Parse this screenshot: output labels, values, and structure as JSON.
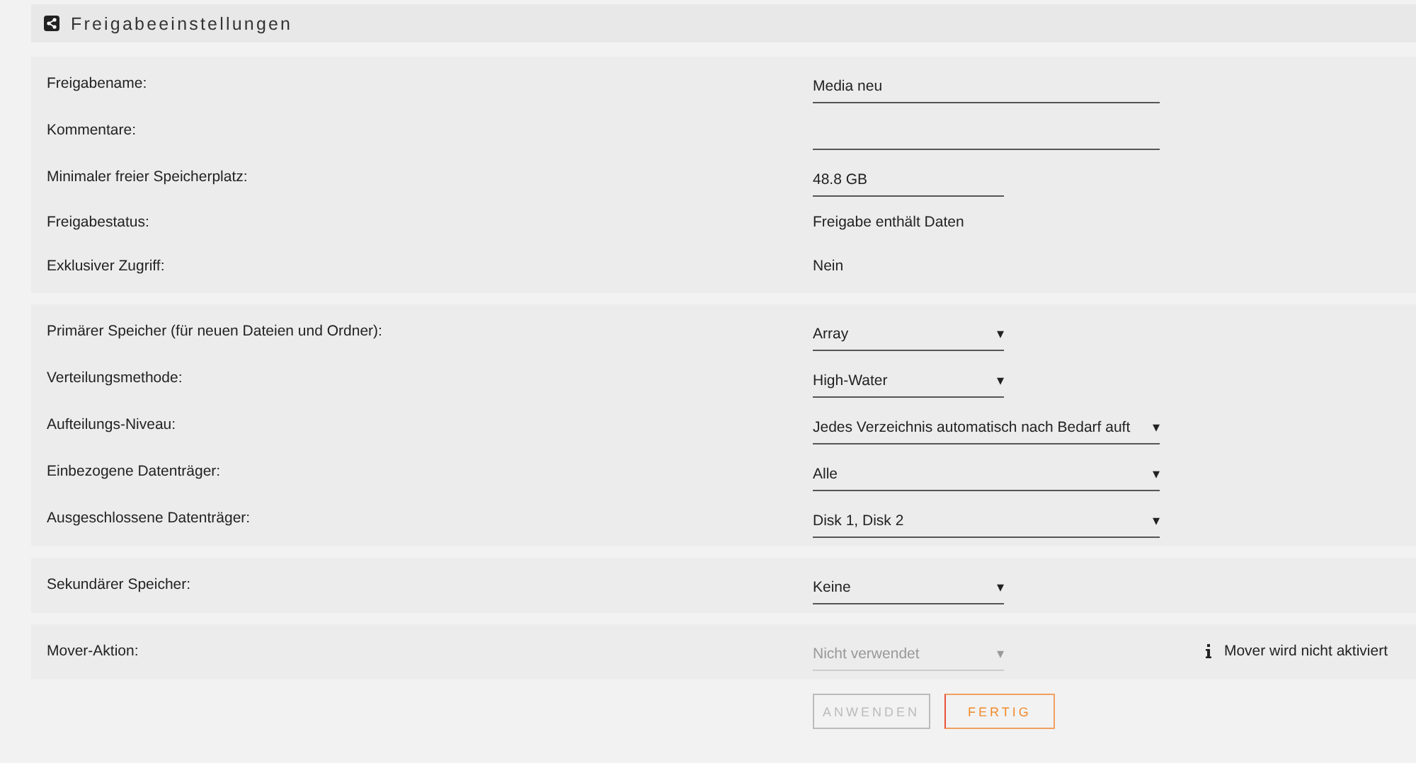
{
  "header": {
    "title": "Freigabeeinstellungen"
  },
  "sections": [
    {
      "rows": [
        {
          "label": "Freigabename:",
          "kind": "text",
          "wide": true,
          "value": "Media neu"
        },
        {
          "label": "Kommentare:",
          "kind": "text",
          "wide": true
        },
        {
          "label": "Minimaler freier Speicherplatz:",
          "kind": "text",
          "wide": false,
          "value": "48.8 GB"
        },
        {
          "label": "Freigabestatus:",
          "kind": "static",
          "value": "Freigabe enthält Daten"
        },
        {
          "label": "Exklusiver Zugriff:",
          "kind": "static",
          "value": "Nein"
        }
      ]
    },
    {
      "rows": [
        {
          "label": "Primärer Speicher (für neuen Dateien und Ordner):",
          "kind": "select",
          "wide": false,
          "value": "Array",
          "arrow": "▾",
          "disabled": false
        },
        {
          "label": "Verteilungsmethode:",
          "kind": "select",
          "wide": false,
          "value": "High-Water",
          "arrow": "▾",
          "disabled": false
        },
        {
          "label": "Aufteilungs-Niveau:",
          "kind": "select",
          "wide": true,
          "value": "Jedes Verzeichnis automatisch nach Bedarf auft",
          "arrow": "▾",
          "disabled": false
        },
        {
          "label": "Einbezogene Datenträger:",
          "kind": "select",
          "wide": true,
          "value": "Alle",
          "arrow": "▾",
          "disabled": false
        },
        {
          "label": "Ausgeschlossene Datenträger:",
          "kind": "select",
          "wide": true,
          "value": "Disk 1, Disk 2",
          "arrow": "▾",
          "disabled": false
        }
      ]
    },
    {
      "rows": [
        {
          "label": "Sekundärer Speicher:",
          "kind": "select",
          "wide": false,
          "value": "Keine",
          "arrow": "▾",
          "disabled": false
        }
      ]
    },
    {
      "rows": [
        {
          "label": "Mover-Aktion:",
          "kind": "select",
          "wide": false,
          "value": "Nicht verwendet",
          "arrow": "▾",
          "disabled": true,
          "note": {
            "text": "Mover wird nicht aktiviert"
          }
        }
      ]
    }
  ],
  "buttons": [
    {
      "label": "ANWENDEN",
      "disabled": true
    },
    {
      "label": "FERTIG",
      "disabled": false
    }
  ]
}
